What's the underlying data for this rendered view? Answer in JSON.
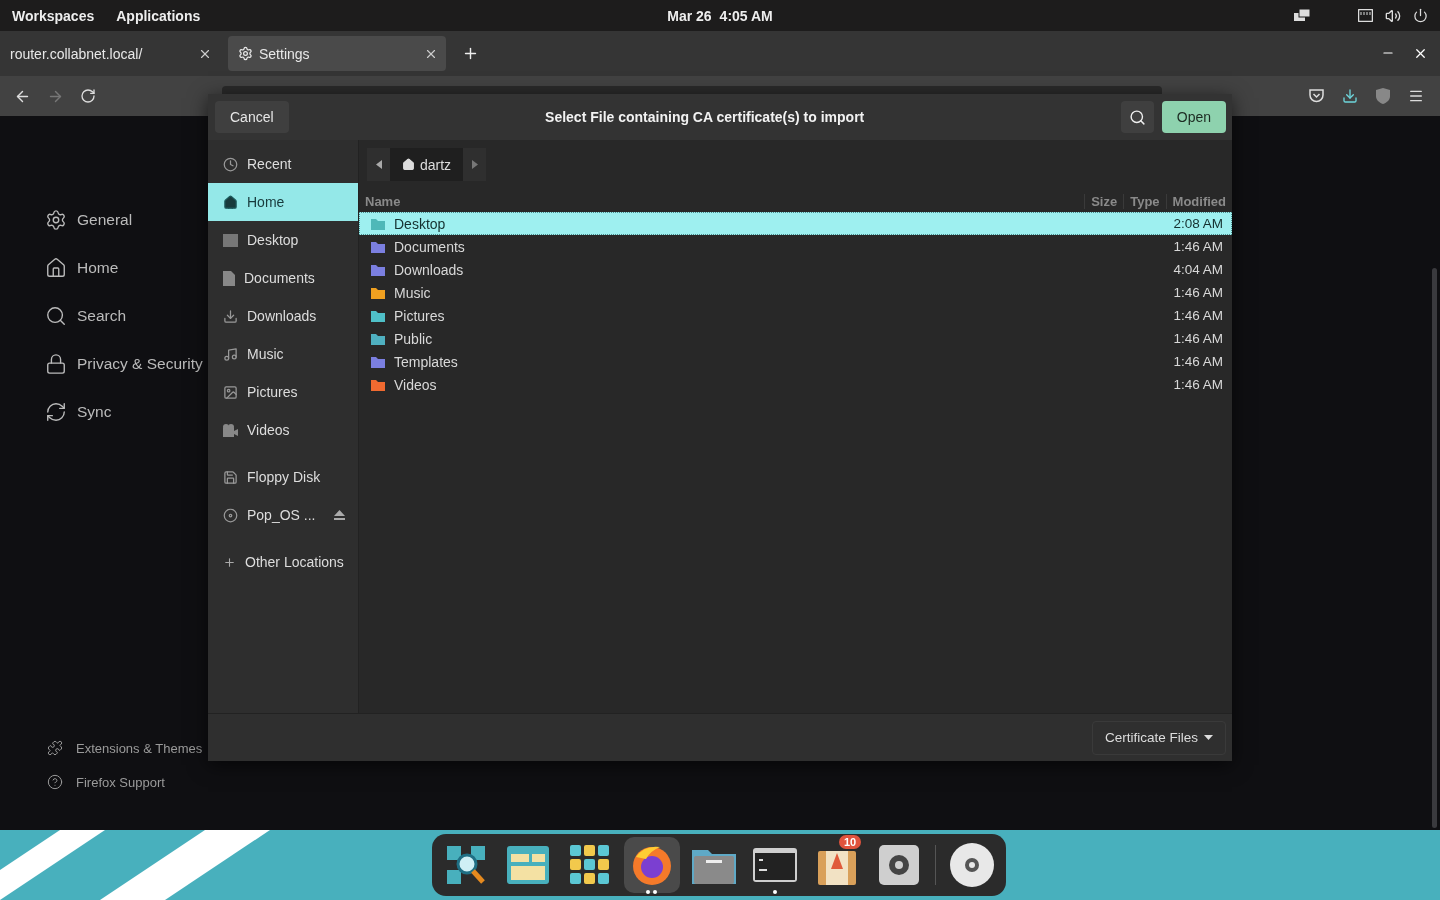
{
  "top_panel": {
    "menus": [
      "Workspaces",
      "Applications"
    ],
    "date": "Mar 26",
    "time": "4:05 AM"
  },
  "browser": {
    "tabs": [
      {
        "label": "router.collabnet.local/",
        "selected": false
      },
      {
        "label": "Settings",
        "selected": true
      }
    ]
  },
  "settings_nav": {
    "items": [
      {
        "label": "General"
      },
      {
        "label": "Home"
      },
      {
        "label": "Search"
      },
      {
        "label": "Privacy & Security"
      },
      {
        "label": "Sync"
      }
    ],
    "footer_links": [
      "Extensions & Themes",
      "Firefox Support"
    ]
  },
  "dialog": {
    "title": "Select File containing CA certificate(s) to import",
    "cancel": "Cancel",
    "open": "Open",
    "places": [
      [
        {
          "label": "Recent",
          "selected": false
        },
        {
          "label": "Home",
          "selected": true
        },
        {
          "label": "Desktop",
          "selected": false
        },
        {
          "label": "Documents",
          "selected": false
        },
        {
          "label": "Downloads",
          "selected": false
        },
        {
          "label": "Music",
          "selected": false
        },
        {
          "label": "Pictures",
          "selected": false
        },
        {
          "label": "Videos",
          "selected": false
        }
      ],
      [
        {
          "label": "Floppy Disk",
          "selected": false,
          "eject": false
        },
        {
          "label": "Pop_OS ...",
          "selected": false,
          "eject": true
        }
      ],
      [
        {
          "label": "Other Locations",
          "selected": false
        }
      ]
    ],
    "path": [
      {
        "label": "dartz",
        "selected": true
      }
    ],
    "columns": [
      "Name",
      "Size",
      "Type",
      "Modified"
    ],
    "rows": [
      {
        "name": "Desktop",
        "modified": "2:08 AM",
        "selected": true,
        "color": "#4fb8b8"
      },
      {
        "name": "Documents",
        "modified": "1:46 AM",
        "selected": false,
        "color": "#7b7fe0"
      },
      {
        "name": "Downloads",
        "modified": "4:04 AM",
        "selected": false,
        "color": "#7b7fe0"
      },
      {
        "name": "Music",
        "modified": "1:46 AM",
        "selected": false,
        "color": "#f0a020"
      },
      {
        "name": "Pictures",
        "modified": "1:46 AM",
        "selected": false,
        "color": "#4fc0c8"
      },
      {
        "name": "Public",
        "modified": "1:46 AM",
        "selected": false,
        "color": "#4fb0c0"
      },
      {
        "name": "Templates",
        "modified": "1:46 AM",
        "selected": false,
        "color": "#7b7fe0"
      },
      {
        "name": "Videos",
        "modified": "1:46 AM",
        "selected": false,
        "color": "#f06a30"
      }
    ],
    "filter": "Certificate Files"
  },
  "dock": {
    "items": [
      {
        "selected": false
      },
      {
        "selected": false
      },
      {
        "selected": false
      },
      {
        "selected": true,
        "windows": [
          {
            "open": true
          },
          {
            "open": true
          }
        ]
      },
      {
        "selected": false
      },
      {
        "selected": false,
        "windows": [
          {
            "open": true
          }
        ]
      },
      {
        "selected": false,
        "badge": "10"
      },
      {
        "selected": false
      },
      {
        "selected": false
      }
    ]
  }
}
